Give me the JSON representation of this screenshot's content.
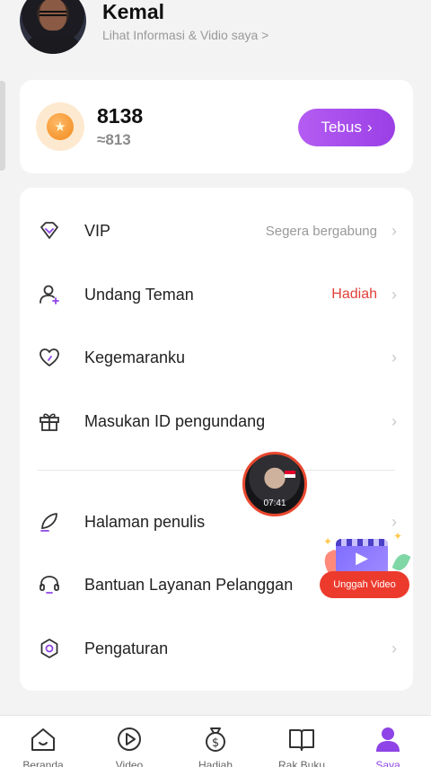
{
  "profile": {
    "name": "Kemal",
    "subtitle": "Lihat Informasi & Vidio saya >"
  },
  "coins": {
    "amount": "8138",
    "approx": "≈813",
    "redeem_label": "Tebus",
    "redeem_chevron": "›"
  },
  "menu": {
    "items": [
      {
        "icon": "diamond-icon",
        "label": "VIP",
        "value": "Segera bergabung",
        "value_color": "#999999"
      },
      {
        "icon": "add-user-icon",
        "label": "Undang Teman",
        "value": "Hadiah",
        "value_color": "#e0403a"
      },
      {
        "icon": "heart-icon",
        "label": "Kegemaranku",
        "value": ""
      },
      {
        "icon": "gift-icon",
        "label": "Masukan ID pengundang",
        "value": ""
      },
      {
        "icon": "quill-icon",
        "label": "Halaman penulis",
        "value": ""
      },
      {
        "icon": "headset-icon",
        "label": "Bantuan Layanan Pelanggan",
        "value": ""
      },
      {
        "icon": "settings-icon",
        "label": "Pengaturan",
        "value": ""
      }
    ],
    "chevron": "›"
  },
  "floating_video": {
    "time": "07:41"
  },
  "upload": {
    "label": "Unggah Video"
  },
  "bottom_nav": {
    "items": [
      {
        "icon": "home-icon",
        "label": "Beranda"
      },
      {
        "icon": "video-play-icon",
        "label": "Video"
      },
      {
        "icon": "money-bag-icon",
        "label": "Hadiah"
      },
      {
        "icon": "book-icon",
        "label": "Rak Buku"
      },
      {
        "icon": "user-icon",
        "label": "Saya",
        "active": true
      }
    ]
  },
  "colors": {
    "accent": "#9b3fe6",
    "alert": "#e0403a",
    "upload": "#ec3b2d"
  }
}
